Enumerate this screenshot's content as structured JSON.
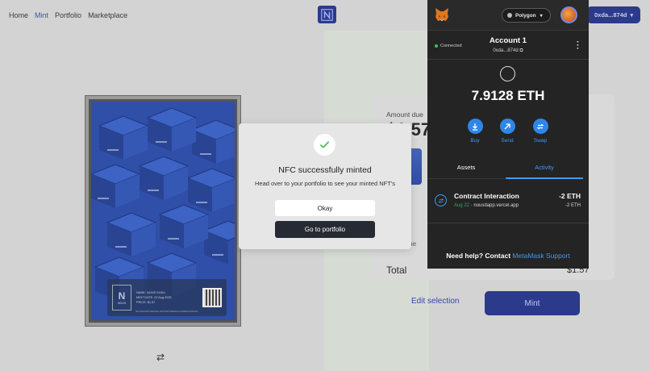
{
  "nav": {
    "links": [
      "Home",
      "Mint",
      "Portfolio",
      "Marketplace"
    ],
    "active": "Mint",
    "wallet_label": "0xda...874d"
  },
  "nft_card": {
    "line1": "NAME: NOUS DOKU",
    "line2": "MINT DATE: 22 Aug 2023",
    "line3": "PRICE: $1.57",
    "badge_text": "NOUS",
    "footer": "NOUSDAPP.VERCEL.APP/NFT/MEDIA/CAMPAIGNS/001"
  },
  "summary": {
    "amount_due_label": "Amount due",
    "amount_due_value": "$1.57",
    "due_label": "ue",
    "total_label": "Total",
    "total_value": "$1.57",
    "edit_label": "Edit selection",
    "mint_label": "Mint"
  },
  "modal": {
    "title": "NFC successfully minted",
    "subtitle": "Head over to your portfolio to see your minted NFT's",
    "okay_label": "Okay",
    "portfolio_label": "Go to portfolio"
  },
  "metamask": {
    "network": "Polygon",
    "connected_label": "Connected",
    "account_name": "Account 1",
    "account_address": "0xda...874d",
    "balance": "7.9128 ETH",
    "actions": [
      "Buy",
      "Send",
      "Swap"
    ],
    "tabs": [
      "Assets",
      "Activity"
    ],
    "active_tab": "Activity",
    "transaction": {
      "title": "Contract Interaction",
      "date": "Aug 22",
      "origin": "nousdapp.vercel.app",
      "amount": "-2 ETH",
      "amount_secondary": "-2 ETH"
    },
    "help_text": "Need help? Contact",
    "help_link": "MetaMask Support"
  },
  "colors": {
    "brand": "#2b3a8c",
    "metamask_blue": "#3f9bf0",
    "metamask_bg": "#242424",
    "success_green": "#3fbf5a"
  }
}
